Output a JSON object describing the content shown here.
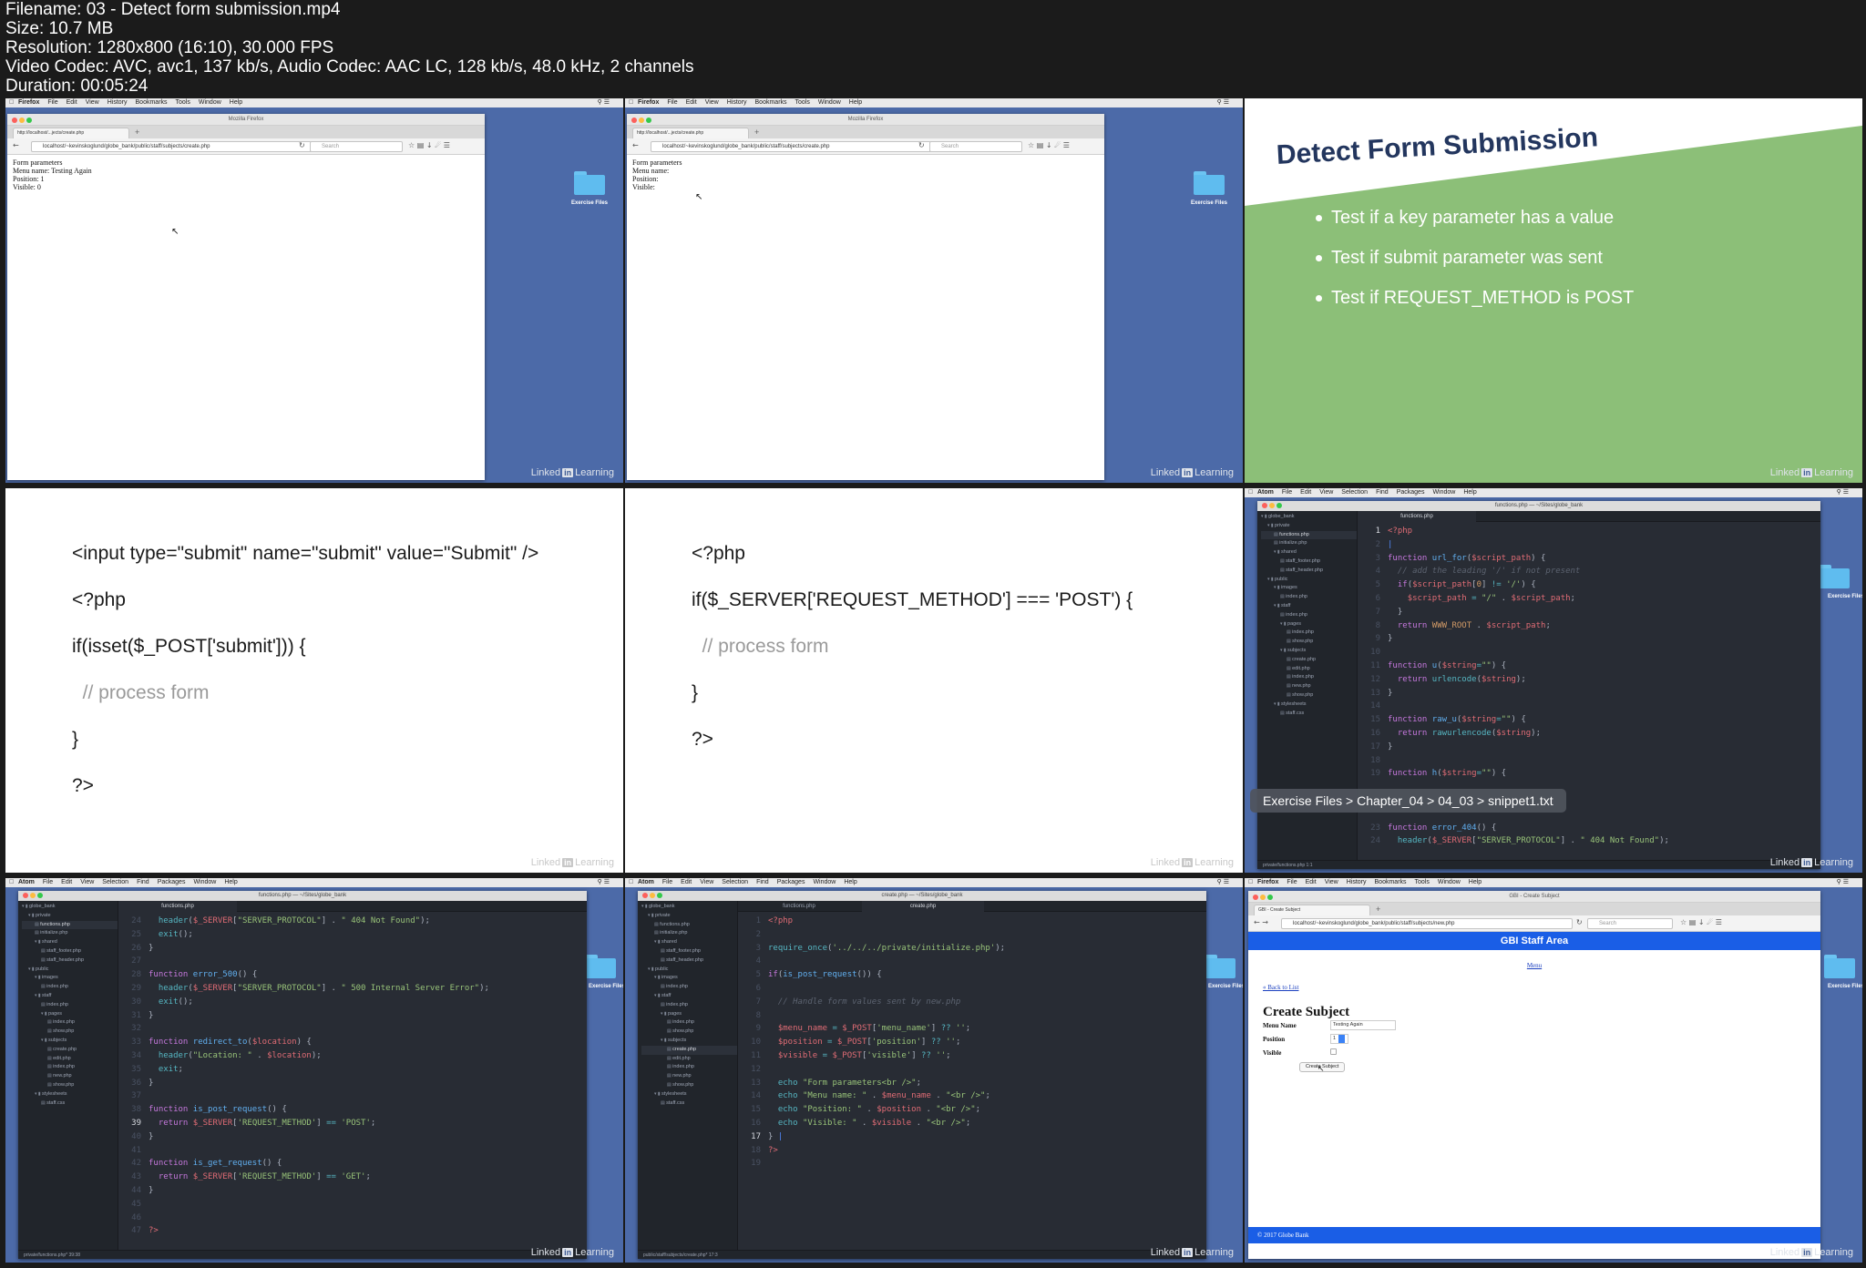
{
  "file_info": {
    "filename": "Filename: 03 - Detect form submission.mp4",
    "size": "Size: 10.7 MB",
    "resolution": "Resolution: 1280x800 (16:10), 30.000 FPS",
    "codec": "Video Codec: AVC, avc1, 137 kb/s, Audio Codec: AAC LC, 128 kb/s, 48.0 kHz, 2 channels",
    "duration": "Duration: 00:05:24"
  },
  "brand": {
    "linked": "Linked",
    "in": "in",
    "learning": "Learning"
  },
  "mac_menu": {
    "firefox": [
      "Firefox",
      "File",
      "Edit",
      "View",
      "History",
      "Bookmarks",
      "Tools",
      "Window",
      "Help"
    ],
    "atom": [
      "Atom",
      "File",
      "Edit",
      "View",
      "Selection",
      "Find",
      "Packages",
      "Window",
      "Help"
    ]
  },
  "desktop": {
    "folder_label": "Exercise Files"
  },
  "frame1": {
    "window_title": "Mozilla Firefox",
    "tab": "http://localhost/...jects/create.php",
    "url": "localhost/~kevinskoglund/globe_bank/public/staff/subjects/create.php",
    "search": "Search",
    "lines": [
      "Form parameters",
      "Menu name: Testing Again",
      "Position: 1",
      "Visible: 0"
    ]
  },
  "frame2": {
    "window_title": "Mozilla Firefox",
    "tab": "http://localhost/...jects/create.php",
    "url": "localhost/~kevinskoglund/globe_bank/public/staff/subjects/create.php",
    "search": "Search",
    "lines": [
      "Form parameters",
      "Menu name:",
      "Position:",
      "Visible:"
    ]
  },
  "frame3": {
    "title": "Detect Form Submission",
    "bullets": [
      "Test if a key parameter has a value",
      "Test if submit parameter was sent",
      "Test if REQUEST_METHOD is POST"
    ],
    "colors": {
      "green": "#8cbf78",
      "title": "#23365e"
    }
  },
  "frame4": {
    "lines": [
      "<input type=\"submit\" name=\"submit\" value=\"Submit\" />",
      "<?php",
      "if(isset($_POST['submit'])) {",
      "  // process form",
      "}",
      "?>"
    ]
  },
  "frame5": {
    "lines": [
      "<?php",
      "if($_SERVER['REQUEST_METHOD'] === 'POST') {",
      "  // process form",
      "}",
      "?>"
    ]
  },
  "frame6": {
    "window_title": "functions.php — ~/Sites/globe_bank",
    "tab": "functions.php",
    "tree": [
      "globe_bank",
      "private",
      "functions.php",
      "initialize.php",
      "shared",
      "staff_footer.php",
      "staff_header.php",
      "public",
      "images",
      "index.php",
      "staff",
      "index.php",
      "pages",
      "index.php",
      "show.php",
      "subjects",
      "create.php",
      "edit.php",
      "index.php",
      "new.php",
      "show.php",
      "stylesheets",
      "staff.css"
    ],
    "line_numbers": [
      "1",
      "2",
      "3",
      "4",
      "5",
      "6",
      "7",
      "8",
      "9",
      "10",
      "11",
      "12",
      "13",
      "14",
      "15",
      "16",
      "17",
      "18",
      "19",
      "",
      "",
      "",
      "23",
      "24"
    ],
    "breadcrumb": "Exercise Files > Chapter_04 > 04_03 > snippet1.txt",
    "status": "private/functions.php   1:1"
  },
  "frame7": {
    "window_title": "functions.php — ~/Sites/globe_bank",
    "tab": "functions.php",
    "tree": [
      "globe_bank",
      "private",
      "functions.php",
      "initialize.php",
      "shared",
      "staff_footer.php",
      "staff_header.php",
      "public",
      "images",
      "index.php",
      "staff",
      "index.php",
      "pages",
      "index.php",
      "show.php",
      "subjects",
      "create.php",
      "edit.php",
      "index.php",
      "new.php",
      "show.php",
      "stylesheets",
      "staff.css"
    ],
    "line_numbers": [
      "24",
      "25",
      "26",
      "27",
      "28",
      "29",
      "30",
      "31",
      "32",
      "33",
      "34",
      "35",
      "36",
      "37",
      "38",
      "39",
      "40",
      "41",
      "42",
      "43",
      "44",
      "45",
      "46",
      "47"
    ],
    "status": "private/functions.php*   39:38"
  },
  "frame8": {
    "window_title": "create.php — ~/Sites/globe_bank",
    "tabs": [
      "functions.php",
      "create.php"
    ],
    "tree": [
      "globe_bank",
      "private",
      "functions.php",
      "initialize.php",
      "shared",
      "staff_footer.php",
      "staff_header.php",
      "public",
      "images",
      "index.php",
      "staff",
      "index.php",
      "pages",
      "index.php",
      "show.php",
      "subjects",
      "create.php",
      "edit.php",
      "index.php",
      "new.php",
      "show.php",
      "stylesheets",
      "staff.css"
    ],
    "line_numbers": [
      "1",
      "2",
      "3",
      "4",
      "5",
      "6",
      "7",
      "8",
      "9",
      "10",
      "11",
      "12",
      "13",
      "14",
      "15",
      "16",
      "17",
      "18",
      "19"
    ],
    "status": "public/staff/subjects/create.php*   17:3"
  },
  "frame9": {
    "window_title": "GBI - Create Subject",
    "tab": "GBI - Create Subject",
    "url": "localhost/~kevinskoglund/globe_bank/public/staff/subjects/new.php",
    "search": "Search",
    "header": "GBI Staff Area",
    "menu_link": "Menu",
    "back_link": "« Back to List",
    "heading": "Create Subject",
    "labels": [
      "Menu Name",
      "Position",
      "Visible"
    ],
    "menu_name_value": "Testing Again",
    "position_value": "1",
    "submit": "Create Subject",
    "footer": "© 2017 Globe Bank",
    "colors": {
      "header": "#1a5ee6"
    }
  }
}
